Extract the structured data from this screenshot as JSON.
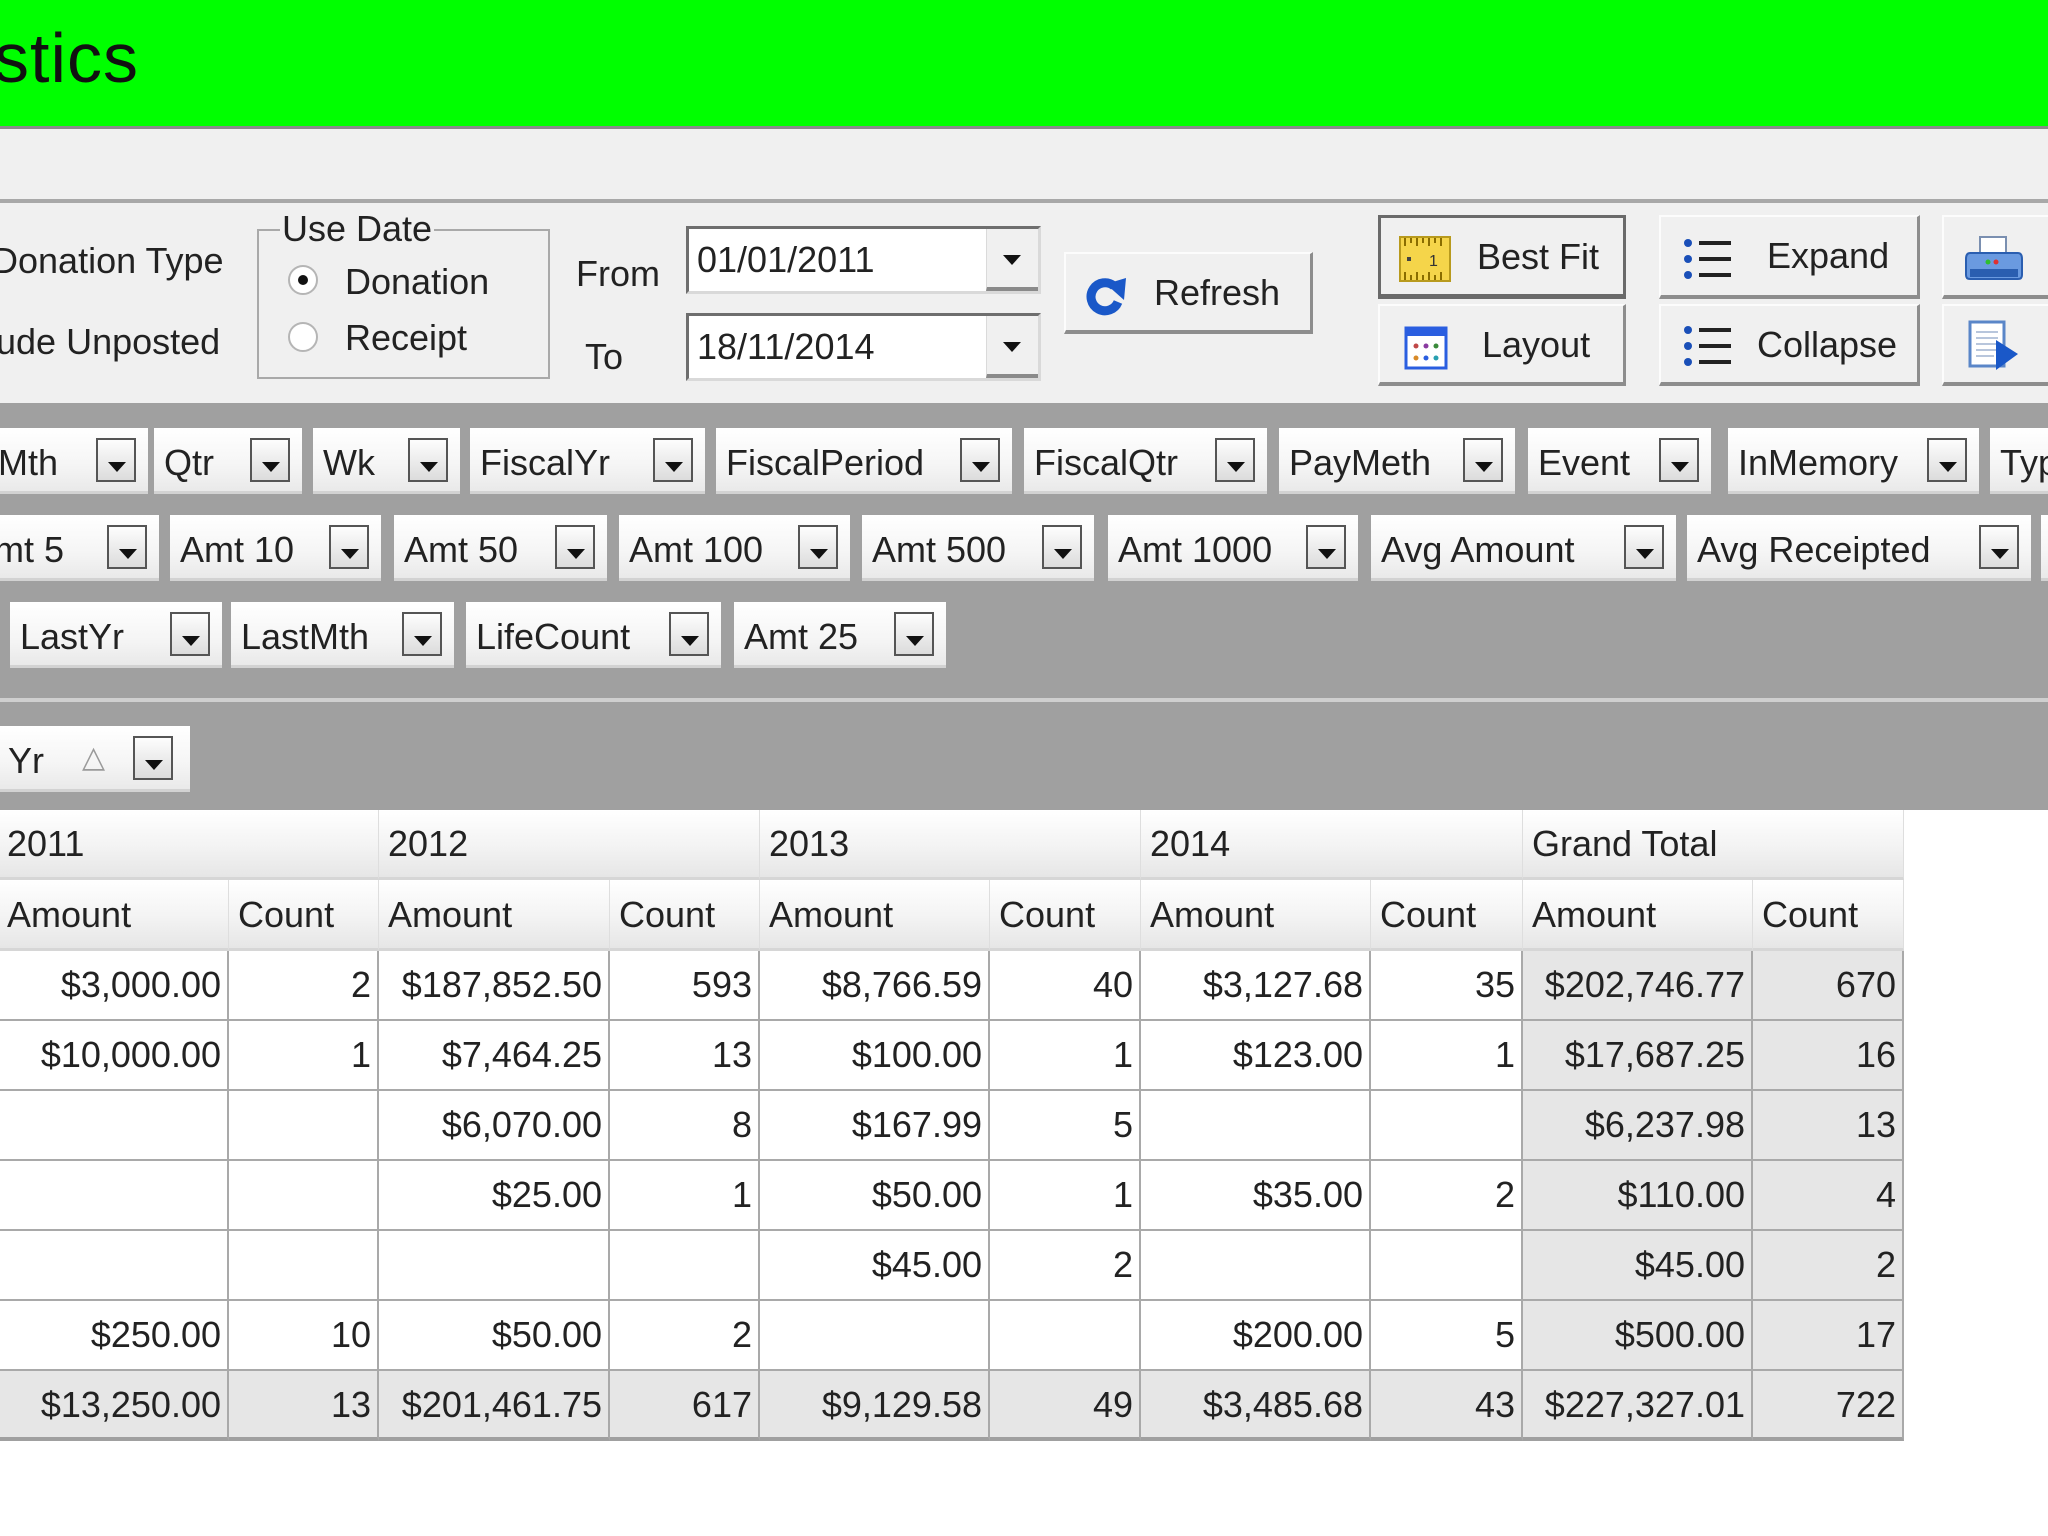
{
  "window": {
    "title_partial": "stics",
    "title_bar_color": "#00ff00"
  },
  "controls": {
    "left_labels": [
      "Donation Type",
      "ude Unposted"
    ],
    "use_date": {
      "legend": "Use Date",
      "options": [
        {
          "label": "Donation",
          "checked": true
        },
        {
          "label": "Receipt",
          "checked": false
        }
      ]
    },
    "from_label": "From",
    "to_label": "To",
    "from_date": "01/01/2011",
    "to_date": "18/11/2014",
    "buttons": {
      "refresh": "Refresh",
      "best_fit": "Best Fit",
      "layout": "Layout",
      "expand": "Expand",
      "collapse": "Collapse"
    }
  },
  "field_list": {
    "row1": [
      "Mth",
      "Qtr",
      "Wk",
      "FiscalYr",
      "FiscalPeriod",
      "FiscalQtr",
      "PayMeth",
      "Event",
      "InMemory",
      "Typ"
    ],
    "row2": [
      "mt 5",
      "Amt 10",
      "Amt 50",
      "Amt 100",
      "Amt 500",
      "Amt 1000",
      "Avg Amount",
      "Avg Receipted",
      ""
    ],
    "row3": [
      "LastYr",
      "LastMth",
      "LifeCount",
      "Amt 25"
    ]
  },
  "column_area": {
    "field": "Yr",
    "sort_indicator": "△"
  },
  "pivot": {
    "years": [
      "2011",
      "2012",
      "2013",
      "2014",
      "Grand Total"
    ],
    "measures": [
      "Amount",
      "Count"
    ],
    "rows": [
      [
        "$3,000.00",
        "2",
        "$187,852.50",
        "593",
        "$8,766.59",
        "40",
        "$3,127.68",
        "35",
        "$202,746.77",
        "670"
      ],
      [
        "$10,000.00",
        "1",
        "$7,464.25",
        "13",
        "$100.00",
        "1",
        "$123.00",
        "1",
        "$17,687.25",
        "16"
      ],
      [
        "",
        "",
        "$6,070.00",
        "8",
        "$167.99",
        "5",
        "",
        "",
        "$6,237.98",
        "13"
      ],
      [
        "",
        "",
        "$25.00",
        "1",
        "$50.00",
        "1",
        "$35.00",
        "2",
        "$110.00",
        "4"
      ],
      [
        "",
        "",
        "",
        "",
        "$45.00",
        "2",
        "",
        "",
        "$45.00",
        "2"
      ],
      [
        "$250.00",
        "10",
        "$50.00",
        "2",
        "",
        "",
        "$200.00",
        "5",
        "$500.00",
        "17"
      ]
    ],
    "totals": [
      "$13,250.00",
      "13",
      "$201,461.75",
      "617",
      "$9,129.58",
      "49",
      "$3,485.68",
      "43",
      "$227,327.01",
      "722"
    ]
  }
}
